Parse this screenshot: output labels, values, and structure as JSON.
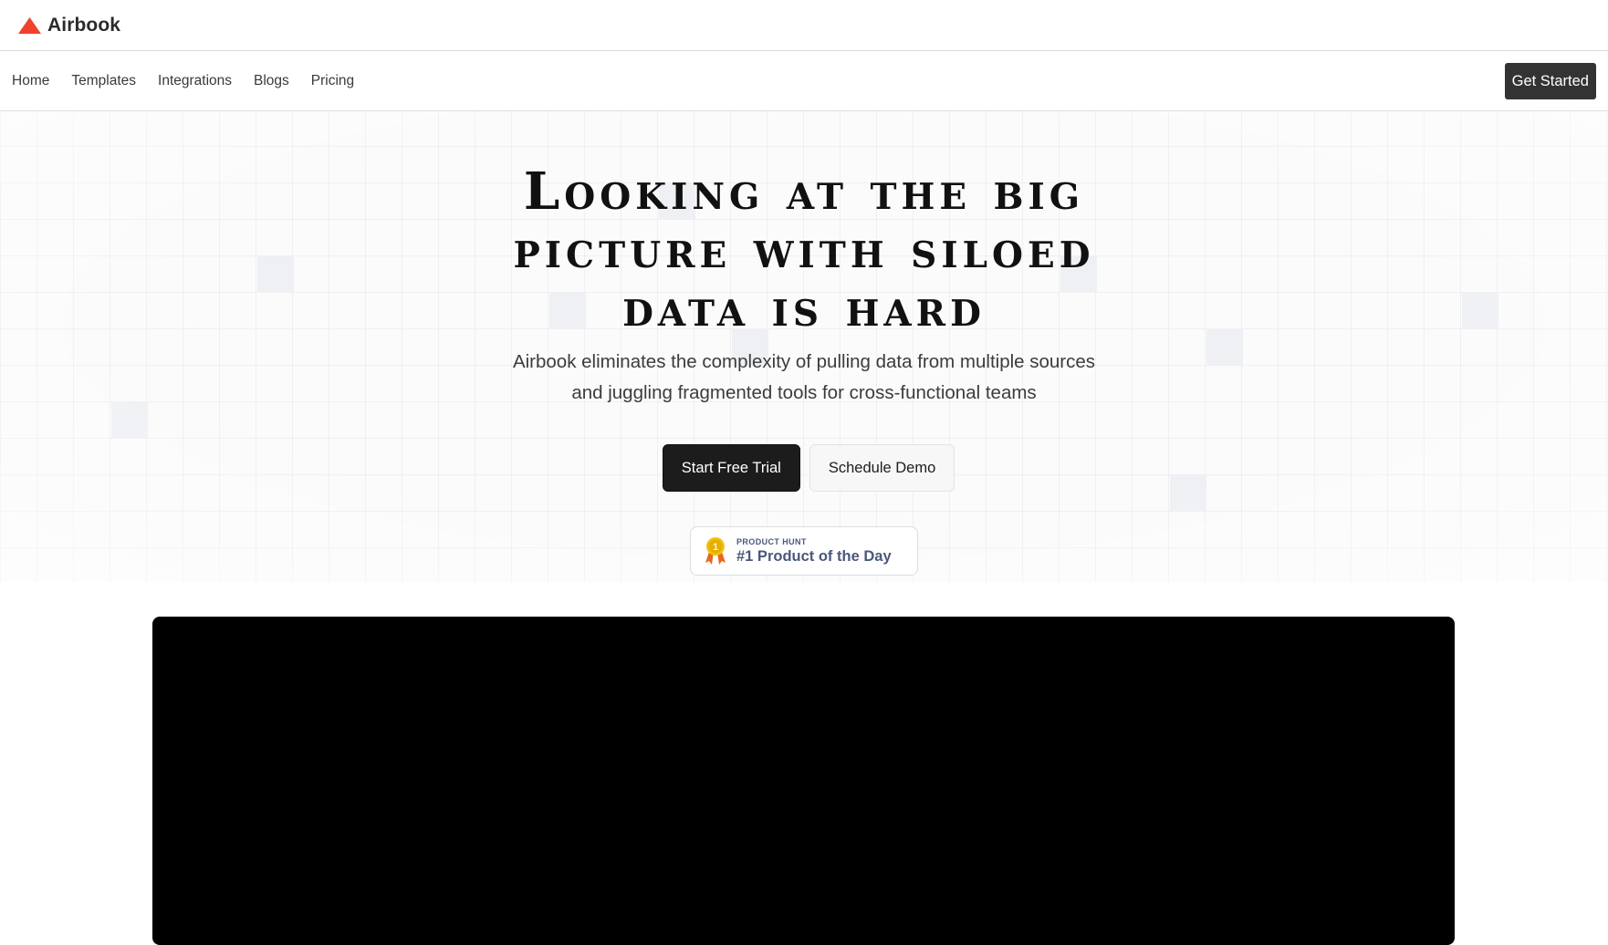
{
  "brand": {
    "name": "Airbook",
    "logo_icon": "red-triangle-logo",
    "accent": "#f0412a"
  },
  "nav": {
    "links": [
      "Home",
      "Templates",
      "Integrations",
      "Blogs",
      "Pricing"
    ],
    "cta_label": "Get Started"
  },
  "hero": {
    "headline_lines": [
      "Looking at the big",
      "picture with siloed",
      "data is hard"
    ],
    "subhead_lines": [
      "Airbook eliminates the complexity of pulling data from multiple sources",
      "and juggling fragmented tools for cross-functional teams"
    ],
    "primary_cta": "Start Free Trial",
    "secondary_cta": "Schedule Demo",
    "badge": {
      "icon": "gold-medal-icon",
      "medal_number": "1",
      "kicker": "PRODUCT HUNT",
      "title": "#1 Product of the Day"
    }
  },
  "video": {
    "icon": "video-player-frame"
  }
}
